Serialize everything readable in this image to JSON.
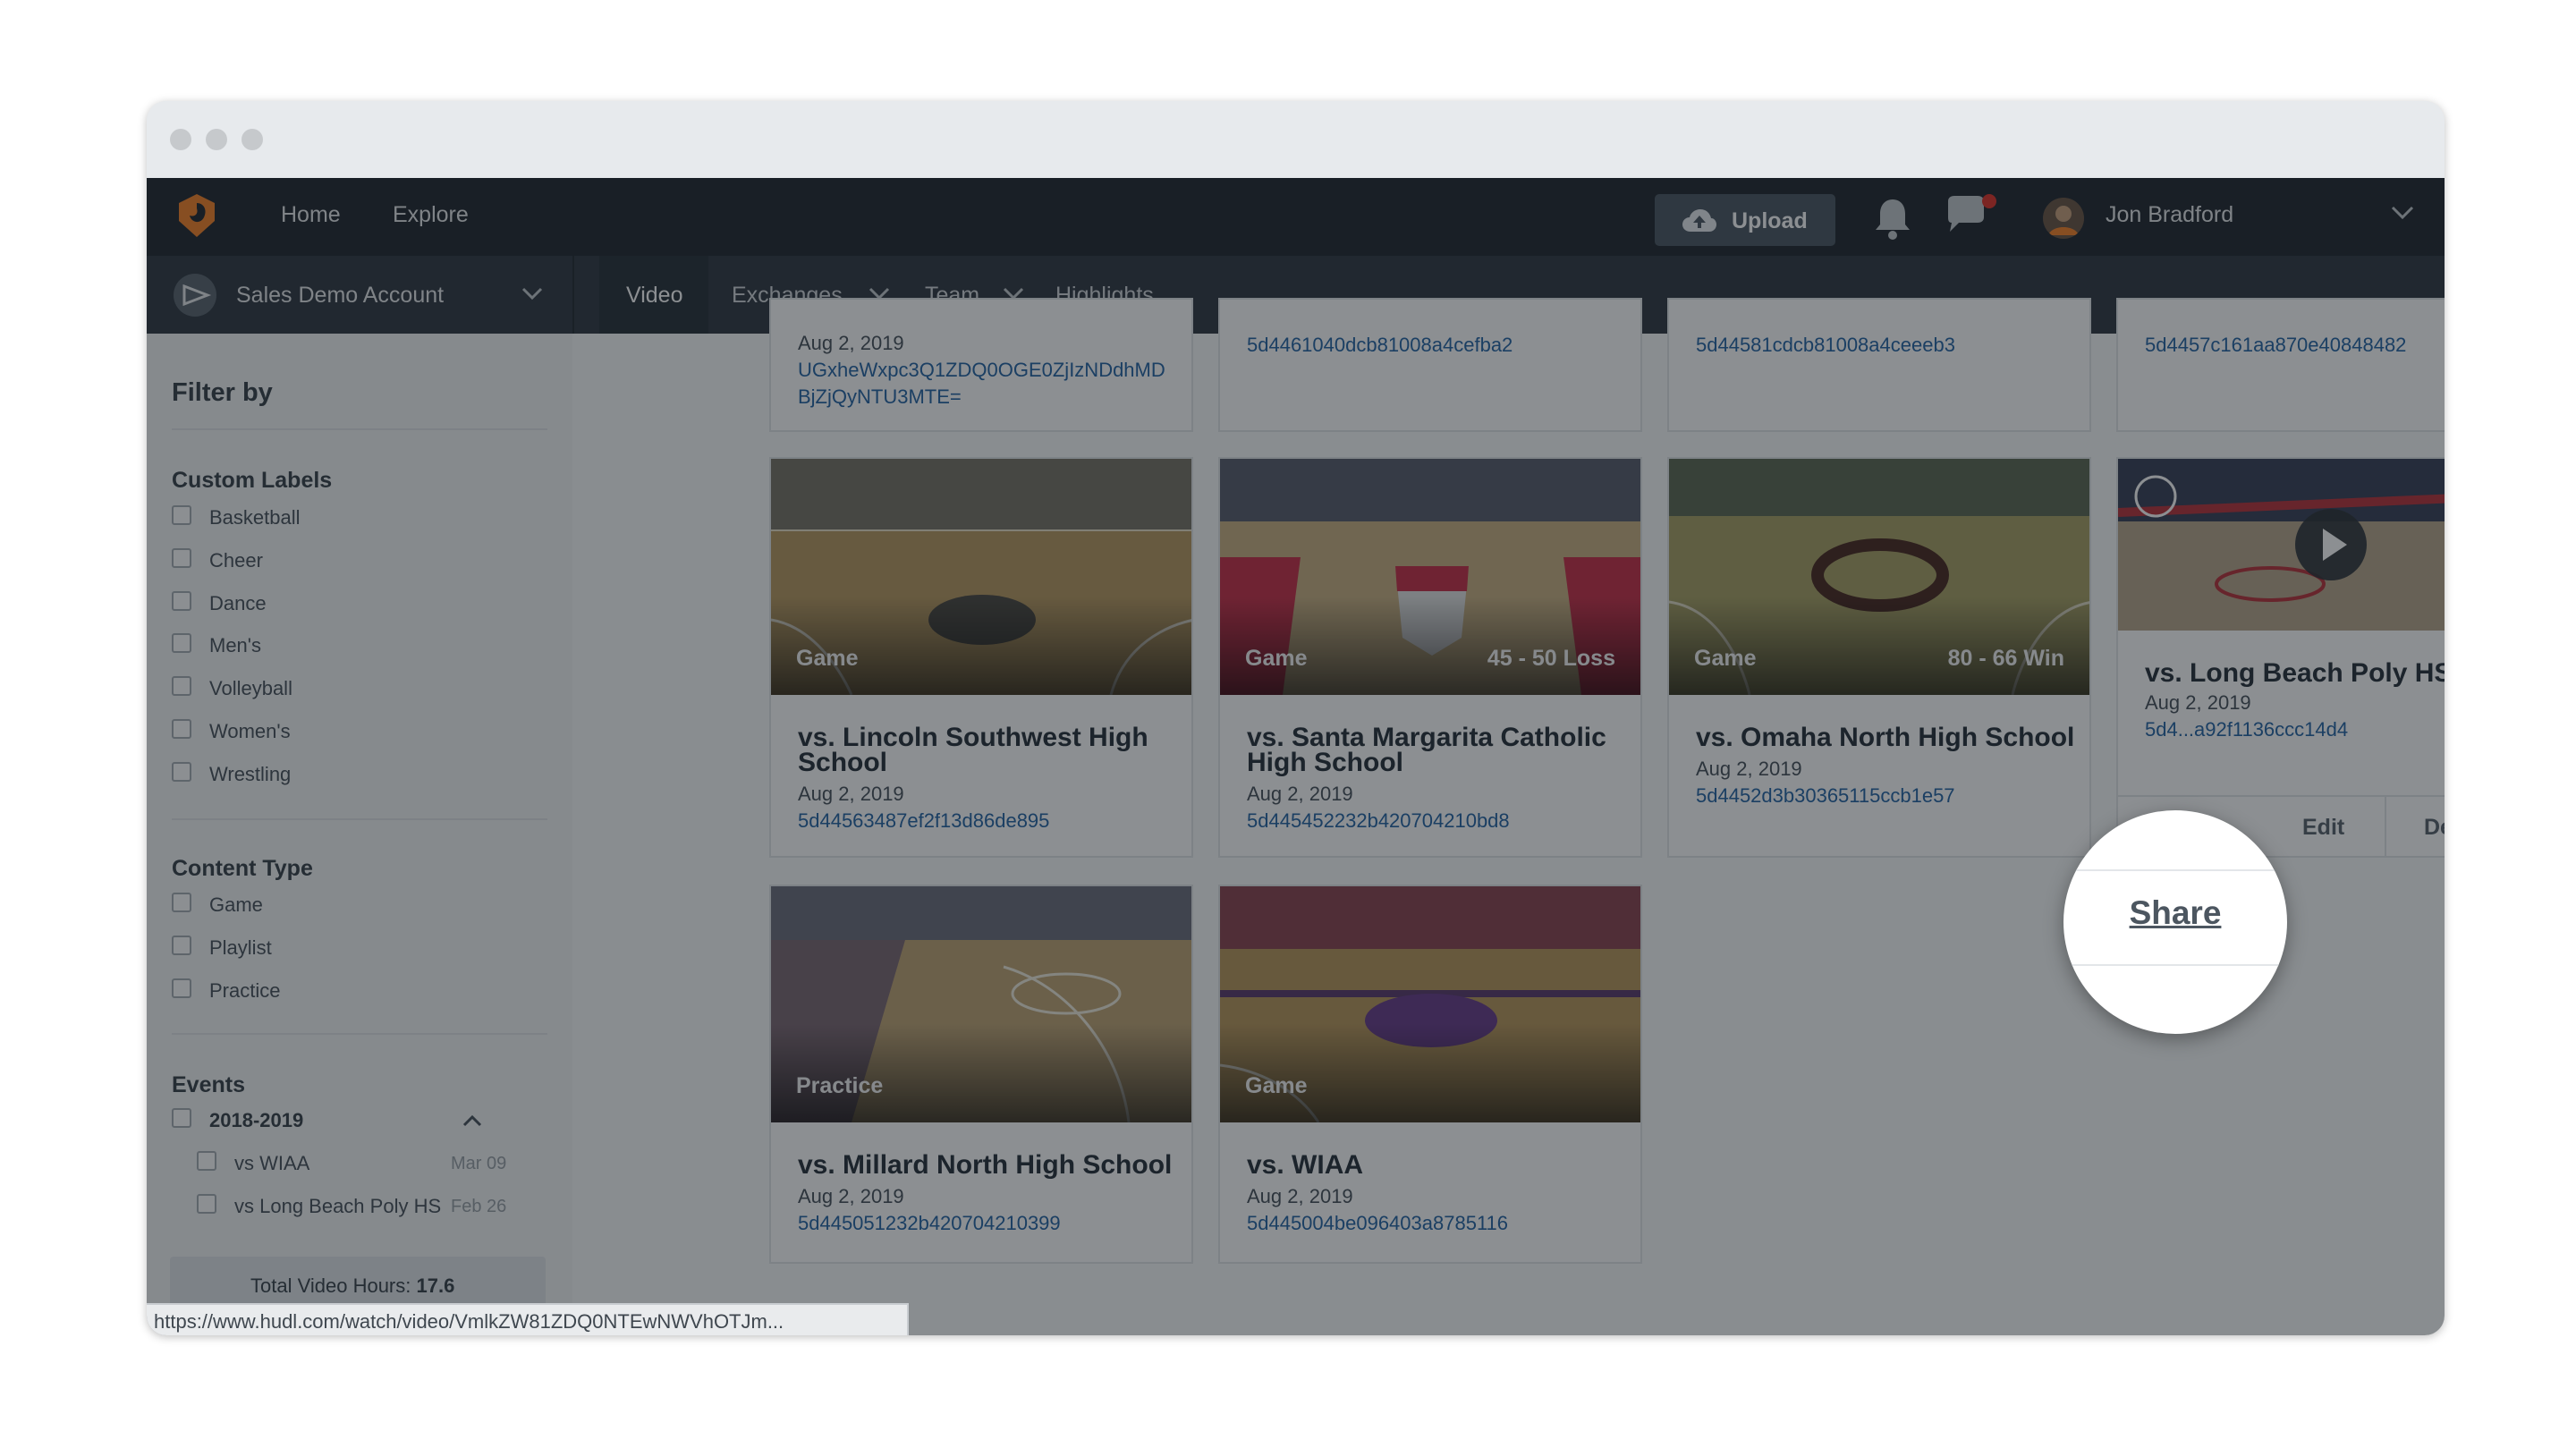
{
  "topnav": {
    "home": "Home",
    "explore": "Explore",
    "upload": "Upload",
    "user_name": "Jon Bradford"
  },
  "subnav": {
    "account": "Sales Demo Account",
    "tabs": [
      "Video",
      "Exchanges",
      "Team",
      "Highlights"
    ]
  },
  "sidebar": {
    "filter_title": "Filter by",
    "custom_labels_title": "Custom Labels",
    "custom_labels": [
      "Basketball",
      "Cheer",
      "Dance",
      "Men's",
      "Volleyball",
      "Women's",
      "Wrestling"
    ],
    "content_type_title": "Content Type",
    "content_types": [
      "Game",
      "Playlist",
      "Practice"
    ],
    "events_title": "Events",
    "season": "2018-2019",
    "events": [
      {
        "name": "vs WIAA",
        "date": "Mar 09"
      },
      {
        "name": "vs Long Beach Poly HS",
        "date": "Feb 26"
      }
    ],
    "total_label": "Total Video Hours:",
    "total_value": "17.6"
  },
  "top_row_partial": [
    {
      "date": "Aug 2, 2019",
      "id_line1": "UGxheWxpc3Q1ZDQ0OGE0ZjIzNDdhMD",
      "id_line2": "BjZjQyNTU3MTE="
    },
    {
      "id": "5d4461040dcb81008a4cefba2"
    },
    {
      "id": "5d44581cdcb81008a4ceeeb3"
    },
    {
      "id": "5d4457c161aa870e40848482"
    }
  ],
  "cards": [
    {
      "type": "Game",
      "score": "",
      "title_line1": "vs. Lincoln Southwest High",
      "title_line2": "School",
      "date": "Aug 2, 2019",
      "id": "5d44563487ef2f13d86de895"
    },
    {
      "type": "Game",
      "score": "45 - 50 Loss",
      "title_line1": "vs. Santa Margarita Catholic",
      "title_line2": "High School",
      "date": "Aug 2, 2019",
      "id": "5d445452232b420704210bd8"
    },
    {
      "type": "Game",
      "score": "80 - 66 Win",
      "title_line1": "vs. Omaha North High School",
      "title_line2": "",
      "date": "Aug 2, 2019",
      "id": "5d4452d3b30365115ccb1e57"
    },
    {
      "type": "",
      "score": "",
      "title_line1": "vs. Long Beach Poly HS",
      "title_line2": "",
      "date": "Aug 2, 2019",
      "id": "5d4...a92f1136ccc14d4"
    },
    {
      "type": "Practice",
      "score": "",
      "title_line1": "vs. Millard North High School",
      "title_line2": "",
      "date": "Aug 2, 2019",
      "id": "5d445051232b420704210399"
    },
    {
      "type": "Game",
      "score": "",
      "title_line1": "vs. WIAA",
      "title_line2": "",
      "date": "Aug 2, 2019",
      "id": "5d445004be096403a8785116"
    }
  ],
  "hover_card_actions": {
    "share": "Share",
    "edit": "Edit",
    "details": "Details"
  },
  "status_url": "https://www.hudl.com/watch/video/VmlkZW81ZDQ0NTEwNWVhOTJm...",
  "colors": {
    "accent_orange": "#f5822a",
    "link_blue": "#2766a6",
    "nav_dark": "#232a31"
  }
}
